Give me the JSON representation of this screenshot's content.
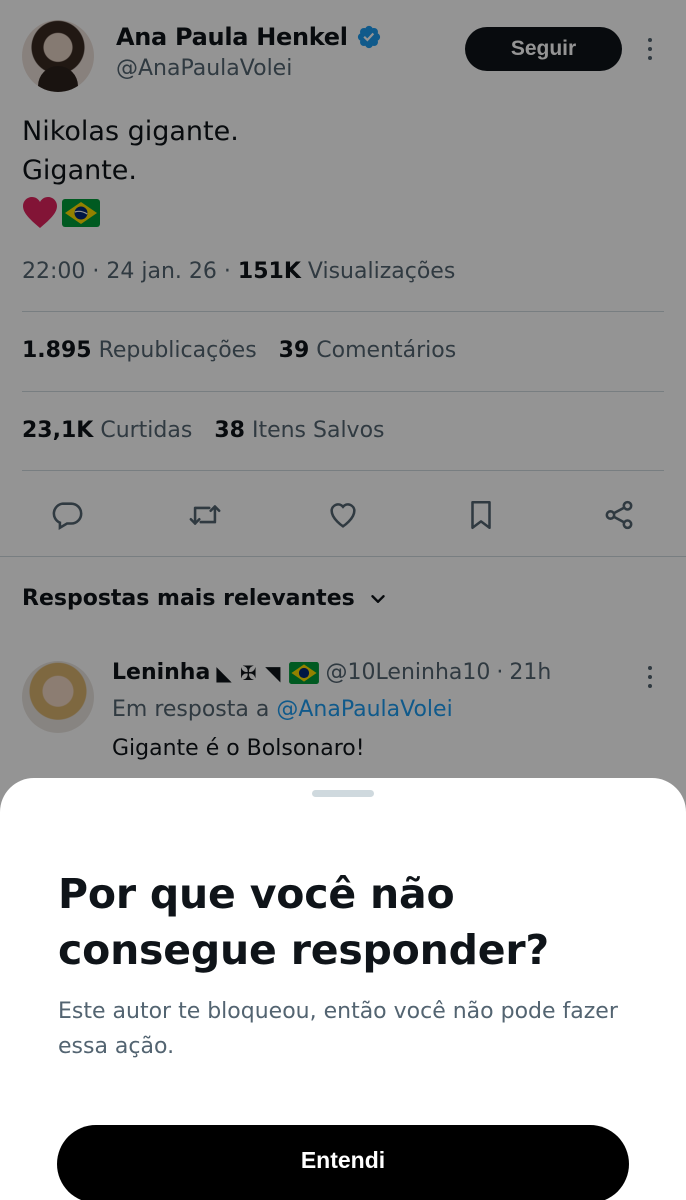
{
  "tweet": {
    "display_name": "Ana Paula Henkel",
    "handle": "@AnaPaulaVolei",
    "follow_label": "Seguir",
    "text_line1": "Nikolas gigante.",
    "text_line2": "Gigante.",
    "time": "22:00",
    "date": "24 jan. 26",
    "views_count": "151K",
    "views_label": "Visualizações",
    "reposts_count": "1.895",
    "reposts_label": "Republicações",
    "comments_count": "39",
    "comments_label": "Comentários",
    "likes_count": "23,1K",
    "likes_label": "Curtidas",
    "saves_count": "38",
    "saves_label": "Itens Salvos"
  },
  "replies": {
    "header": "Respostas mais relevantes",
    "first": {
      "name": "Leninha",
      "symbols": "◣ ✠ ◥",
      "handle": "@10Leninha10",
      "age": "21h",
      "reply_to_prefix": "Em resposta a",
      "reply_to_handle": "@AnaPaulaVolei",
      "text": "Gigante é o Bolsonaro!"
    }
  },
  "sheet": {
    "title": "Por que você não consegue responder?",
    "body": "Este autor te bloqueou, então você não pode fazer essa ação.",
    "button_label": "Entendi"
  },
  "colors": {
    "accent": "#1d9bf0",
    "text_primary": "#0f1419",
    "text_secondary": "#536471",
    "like_heart": "#e0245e"
  }
}
